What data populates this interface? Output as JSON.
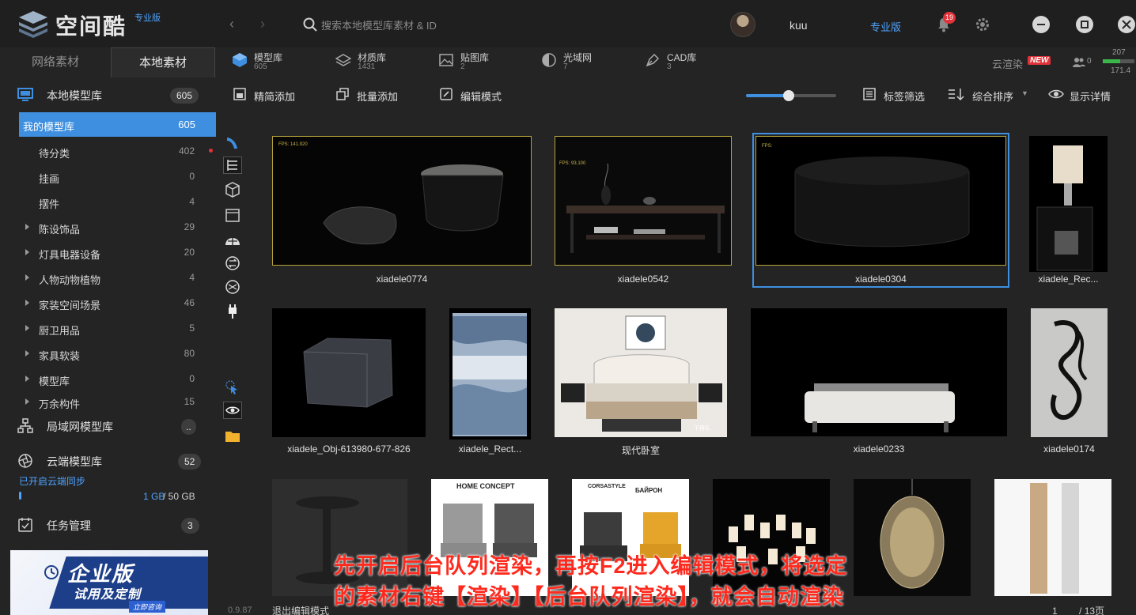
{
  "app": {
    "title": "空间酷",
    "edition_tag": "专业版"
  },
  "search": {
    "placeholder": "搜索本地模型库素材 & ID"
  },
  "user": {
    "name": "kuu",
    "pro_link": "专业版",
    "notifications": "19"
  },
  "sidebar": {
    "tabs": [
      "网络素材",
      "本地素材"
    ],
    "local_lib": {
      "label": "本地模型库",
      "count": "605"
    },
    "my_lib": {
      "label": "我的模型库",
      "count": "605"
    },
    "categories": [
      {
        "label": "待分类",
        "count": "402",
        "expandable": false
      },
      {
        "label": "挂画",
        "count": "0",
        "expandable": false
      },
      {
        "label": "摆件",
        "count": "4",
        "expandable": false
      },
      {
        "label": "陈设饰品",
        "count": "29",
        "expandable": true
      },
      {
        "label": "灯具电器设备",
        "count": "20",
        "expandable": true
      },
      {
        "label": "人物动物植物",
        "count": "4",
        "expandable": true
      },
      {
        "label": "家装空间场景",
        "count": "46",
        "expandable": true
      },
      {
        "label": "厨卫用品",
        "count": "5",
        "expandable": true
      },
      {
        "label": "家具软装",
        "count": "80",
        "expandable": true
      },
      {
        "label": "模型库",
        "count": "0",
        "expandable": true
      },
      {
        "label": "万余构件",
        "count": "15",
        "expandable": true
      }
    ],
    "lan_lib": {
      "label": "局域网模型库",
      "count": ".."
    },
    "cloud_lib": {
      "label": "云端模型库",
      "count": "52"
    },
    "sync_text": "已开启云端同步",
    "storage_used": "1 GB",
    "storage_total": "/ 50 GB",
    "storage_fraction": 0.02,
    "tasks": {
      "label": "任务管理",
      "count": "3"
    },
    "promo": {
      "title": "企业版",
      "subtitle": "试用及定制",
      "cta": "立即咨询"
    },
    "version": "0.9.87"
  },
  "lib_tabs": [
    {
      "label": "模型库",
      "count": "605"
    },
    {
      "label": "材质库",
      "count": "1431"
    },
    {
      "label": "贴图库",
      "count": "2"
    },
    {
      "label": "光域网",
      "count": "7"
    },
    {
      "label": "CAD库",
      "count": "3"
    }
  ],
  "render": {
    "label": "云渲染",
    "badge": "NEW",
    "queue_count": "0",
    "disk_top": "207",
    "disk_bottom": "171.4",
    "disk_fraction": 0.55
  },
  "toolbar": {
    "simple_add": "精简添加",
    "batch_add": "批量添加",
    "edit_mode": "编辑模式",
    "zoom_fraction": 0.47,
    "tag_filter": "标签筛选",
    "sort": "综合排序",
    "show_details": "显示详情"
  },
  "grid": {
    "row1": [
      "xiadele0774",
      "xiadele0542",
      "xiadele0304",
      "xiadele_Rec..."
    ],
    "row2": [
      "xiadele_Obj-613980-677-826",
      "xiadele_Rect...",
      "现代卧室",
      "xiadele0233",
      "xiadele0174"
    ],
    "fps1": "FPS:    141.920",
    "fps3": "FPS:",
    "fps2": "FPS:    93.100",
    "home_concept": "HOME CONCEPT",
    "corsa": "CORSASTYLE",
    "bayron": "БАЙРОН",
    "watermark": "下得乐"
  },
  "caption": {
    "line1": "先开启后台队列渲染，再按F2进入编辑模式，将选定",
    "line2": "的素材右键【渲染】【后台队列渲染】，就会自动渲染"
  },
  "footer": {
    "exit_edit": "退出编辑模式",
    "page_current": "1",
    "page_total": "/ 13页"
  }
}
